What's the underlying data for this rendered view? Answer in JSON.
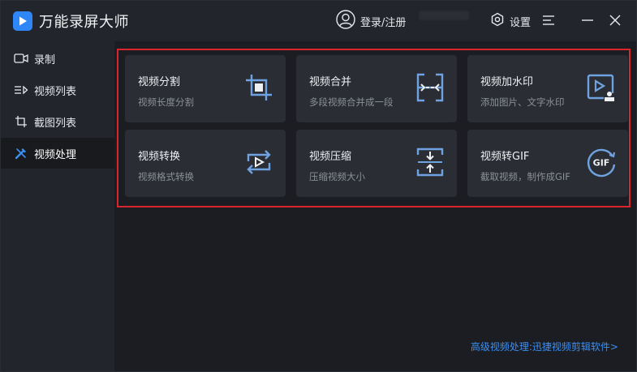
{
  "app": {
    "title": "万能录屏大师",
    "login_label": "登录/注册",
    "settings_label": "设置"
  },
  "icons": {
    "logo": "play-logo-icon",
    "user": "user-icon",
    "settings": "gear-icon",
    "menu": "menu-icon",
    "minimize": "minimize-icon",
    "close": "close-icon"
  },
  "sidebar": {
    "items": [
      {
        "label": "录制",
        "icon": "camera-icon"
      },
      {
        "label": "视频列表",
        "icon": "list-icon"
      },
      {
        "label": "截图列表",
        "icon": "screenshot-icon"
      },
      {
        "label": "视频处理",
        "icon": "tools-icon",
        "active": true
      }
    ]
  },
  "cards": [
    {
      "title": "视频分割",
      "desc": "视频长度分割",
      "icon": "crop-icon"
    },
    {
      "title": "视频合并",
      "desc": "多段视频合并成一段",
      "icon": "merge-icon"
    },
    {
      "title": "视频加水印",
      "desc": "添加图片、文字水印",
      "icon": "watermark-icon"
    },
    {
      "title": "视频转换",
      "desc": "视频格式转换",
      "icon": "convert-icon"
    },
    {
      "title": "视频压缩",
      "desc": "压缩视频大小",
      "icon": "compress-icon"
    },
    {
      "title": "视频转GIF",
      "desc": "截取视频，制作成GIF",
      "icon": "gif-icon",
      "icon_text": "GIF"
    }
  ],
  "footer": {
    "link": "高级视频处理:迅捷视频剪辑软件>"
  },
  "colors": {
    "accent": "#2f86f6",
    "link": "#3d8ff2",
    "highlight": "#d8262c",
    "icon_stroke": "#6fa2e0"
  }
}
